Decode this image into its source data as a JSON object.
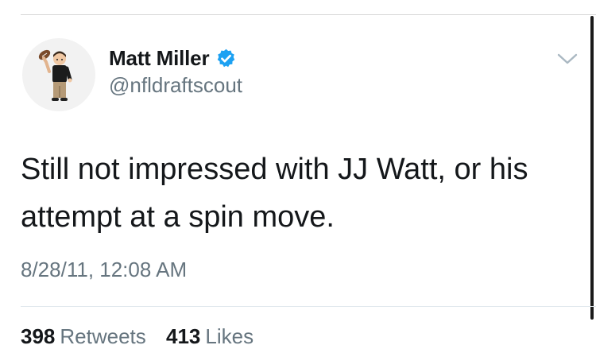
{
  "tweet": {
    "display_name": "Matt Miller",
    "handle": "@nfldraftscout",
    "text": "Still not impressed with JJ Watt, or his attempt at a spin move.",
    "timestamp": "8/28/11, 12:08 AM",
    "verified": true
  },
  "stats": {
    "retweets_count": "398",
    "retweets_label": "Retweets",
    "likes_count": "413",
    "likes_label": "Likes"
  },
  "icons": {
    "verified": "verified-badge-icon",
    "menu": "chevron-down-icon",
    "avatar": "bitmoji-football-player"
  },
  "colors": {
    "verified_blue": "#1da1f2",
    "text": "#14171a",
    "secondary_text": "#66757f"
  }
}
